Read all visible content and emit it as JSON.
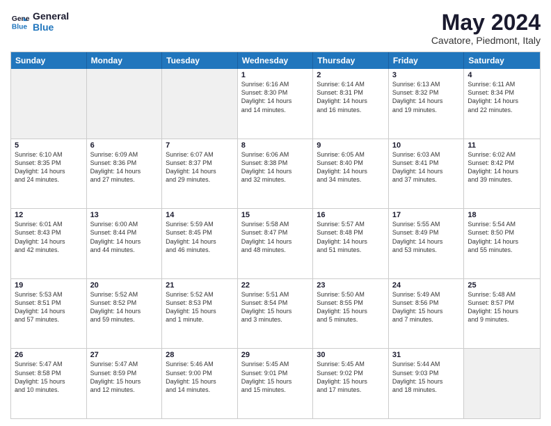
{
  "logo": {
    "line1": "General",
    "line2": "Blue"
  },
  "title": "May 2024",
  "subtitle": "Cavatore, Piedmont, Italy",
  "dayHeaders": [
    "Sunday",
    "Monday",
    "Tuesday",
    "Wednesday",
    "Thursday",
    "Friday",
    "Saturday"
  ],
  "rows": [
    [
      {
        "day": "",
        "info": ""
      },
      {
        "day": "",
        "info": ""
      },
      {
        "day": "",
        "info": ""
      },
      {
        "day": "1",
        "info": "Sunrise: 6:16 AM\nSunset: 8:30 PM\nDaylight: 14 hours\nand 14 minutes."
      },
      {
        "day": "2",
        "info": "Sunrise: 6:14 AM\nSunset: 8:31 PM\nDaylight: 14 hours\nand 16 minutes."
      },
      {
        "day": "3",
        "info": "Sunrise: 6:13 AM\nSunset: 8:32 PM\nDaylight: 14 hours\nand 19 minutes."
      },
      {
        "day": "4",
        "info": "Sunrise: 6:11 AM\nSunset: 8:34 PM\nDaylight: 14 hours\nand 22 minutes."
      }
    ],
    [
      {
        "day": "5",
        "info": "Sunrise: 6:10 AM\nSunset: 8:35 PM\nDaylight: 14 hours\nand 24 minutes."
      },
      {
        "day": "6",
        "info": "Sunrise: 6:09 AM\nSunset: 8:36 PM\nDaylight: 14 hours\nand 27 minutes."
      },
      {
        "day": "7",
        "info": "Sunrise: 6:07 AM\nSunset: 8:37 PM\nDaylight: 14 hours\nand 29 minutes."
      },
      {
        "day": "8",
        "info": "Sunrise: 6:06 AM\nSunset: 8:38 PM\nDaylight: 14 hours\nand 32 minutes."
      },
      {
        "day": "9",
        "info": "Sunrise: 6:05 AM\nSunset: 8:40 PM\nDaylight: 14 hours\nand 34 minutes."
      },
      {
        "day": "10",
        "info": "Sunrise: 6:03 AM\nSunset: 8:41 PM\nDaylight: 14 hours\nand 37 minutes."
      },
      {
        "day": "11",
        "info": "Sunrise: 6:02 AM\nSunset: 8:42 PM\nDaylight: 14 hours\nand 39 minutes."
      }
    ],
    [
      {
        "day": "12",
        "info": "Sunrise: 6:01 AM\nSunset: 8:43 PM\nDaylight: 14 hours\nand 42 minutes."
      },
      {
        "day": "13",
        "info": "Sunrise: 6:00 AM\nSunset: 8:44 PM\nDaylight: 14 hours\nand 44 minutes."
      },
      {
        "day": "14",
        "info": "Sunrise: 5:59 AM\nSunset: 8:45 PM\nDaylight: 14 hours\nand 46 minutes."
      },
      {
        "day": "15",
        "info": "Sunrise: 5:58 AM\nSunset: 8:47 PM\nDaylight: 14 hours\nand 48 minutes."
      },
      {
        "day": "16",
        "info": "Sunrise: 5:57 AM\nSunset: 8:48 PM\nDaylight: 14 hours\nand 51 minutes."
      },
      {
        "day": "17",
        "info": "Sunrise: 5:55 AM\nSunset: 8:49 PM\nDaylight: 14 hours\nand 53 minutes."
      },
      {
        "day": "18",
        "info": "Sunrise: 5:54 AM\nSunset: 8:50 PM\nDaylight: 14 hours\nand 55 minutes."
      }
    ],
    [
      {
        "day": "19",
        "info": "Sunrise: 5:53 AM\nSunset: 8:51 PM\nDaylight: 14 hours\nand 57 minutes."
      },
      {
        "day": "20",
        "info": "Sunrise: 5:52 AM\nSunset: 8:52 PM\nDaylight: 14 hours\nand 59 minutes."
      },
      {
        "day": "21",
        "info": "Sunrise: 5:52 AM\nSunset: 8:53 PM\nDaylight: 15 hours\nand 1 minute."
      },
      {
        "day": "22",
        "info": "Sunrise: 5:51 AM\nSunset: 8:54 PM\nDaylight: 15 hours\nand 3 minutes."
      },
      {
        "day": "23",
        "info": "Sunrise: 5:50 AM\nSunset: 8:55 PM\nDaylight: 15 hours\nand 5 minutes."
      },
      {
        "day": "24",
        "info": "Sunrise: 5:49 AM\nSunset: 8:56 PM\nDaylight: 15 hours\nand 7 minutes."
      },
      {
        "day": "25",
        "info": "Sunrise: 5:48 AM\nSunset: 8:57 PM\nDaylight: 15 hours\nand 9 minutes."
      }
    ],
    [
      {
        "day": "26",
        "info": "Sunrise: 5:47 AM\nSunset: 8:58 PM\nDaylight: 15 hours\nand 10 minutes."
      },
      {
        "day": "27",
        "info": "Sunrise: 5:47 AM\nSunset: 8:59 PM\nDaylight: 15 hours\nand 12 minutes."
      },
      {
        "day": "28",
        "info": "Sunrise: 5:46 AM\nSunset: 9:00 PM\nDaylight: 15 hours\nand 14 minutes."
      },
      {
        "day": "29",
        "info": "Sunrise: 5:45 AM\nSunset: 9:01 PM\nDaylight: 15 hours\nand 15 minutes."
      },
      {
        "day": "30",
        "info": "Sunrise: 5:45 AM\nSunset: 9:02 PM\nDaylight: 15 hours\nand 17 minutes."
      },
      {
        "day": "31",
        "info": "Sunrise: 5:44 AM\nSunset: 9:03 PM\nDaylight: 15 hours\nand 18 minutes."
      },
      {
        "day": "",
        "info": ""
      }
    ]
  ]
}
